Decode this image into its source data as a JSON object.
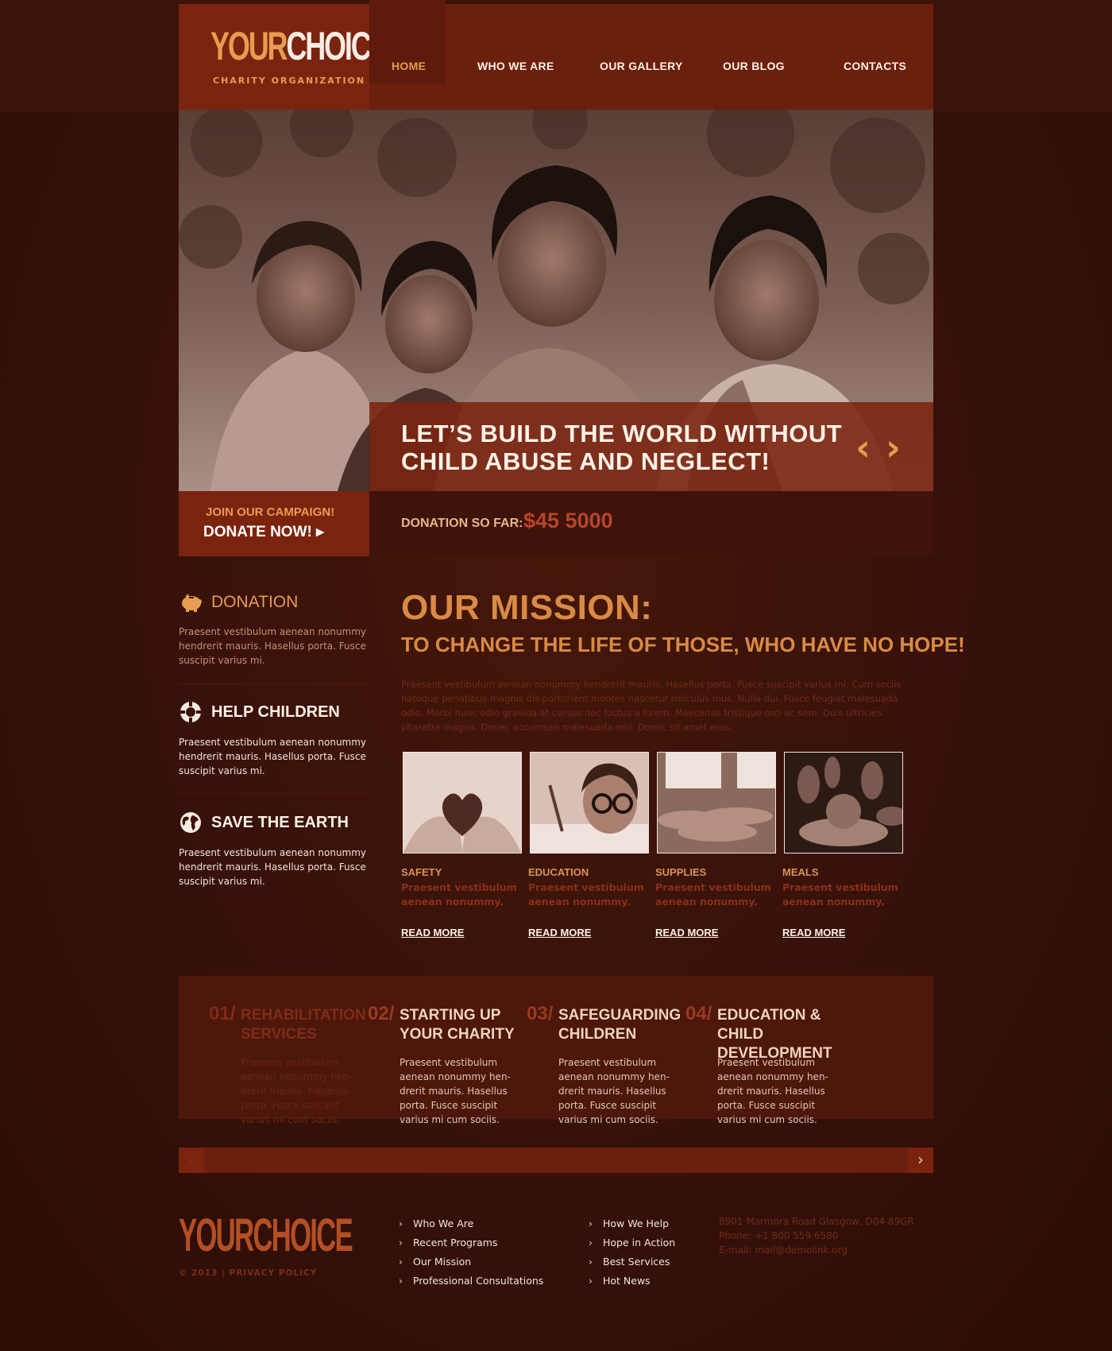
{
  "header": {
    "logo_your": "YOUR",
    "logo_choice": "CHOICE",
    "logo_sub": "CHARITY ORGANIZATION",
    "nav": [
      {
        "label": "HOME",
        "active": true
      },
      {
        "label": "WHO WE ARE"
      },
      {
        "label": "OUR GALLERY"
      },
      {
        "label": "OUR BLOG"
      },
      {
        "label": "CONTACTS"
      }
    ]
  },
  "hero": {
    "title": "LET’S BUILD THE WORLD WITHOUT CHILD ABUSE AND NEGLECT!",
    "prev_icon": "‹",
    "next_icon": "›"
  },
  "donate": {
    "join": "JOIN OUR CAMPAIGN!",
    "now": "DONATE NOW! ▸",
    "label": "DONATION SO FAR:",
    "amount": "$45 5000"
  },
  "side": [
    {
      "title": "DONATION",
      "icon": "piggy-bank-icon",
      "text": "Praesent vestibulum aenean nonummy hendrerit mauris. Hasellus porta. Fusce suscipit varius mi."
    },
    {
      "title": "HELP CHILDREN",
      "icon": "lifebuoy-icon",
      "text": "Praesent vestibulum aenean nonummy hendrerit mauris. Hasellus porta. Fusce suscipit varius mi."
    },
    {
      "title": "SAVE THE EARTH",
      "icon": "globe-icon",
      "text": "Praesent vestibulum aenean nonummy hendrerit mauris. Hasellus porta. Fusce suscipit varius mi."
    }
  ],
  "mission": {
    "title": "OUR MISSION:",
    "subtitle": "TO CHANGE THE LIFE OF THOSE, WHO HAVE NO HOPE!",
    "text": "Praesent vestibulum aenean nonummy hendrerit mauris. Hasellus porta. Fusce suscipit varius mi. Cum sociis natoque penatibus magnis dis parturient montes nascetur ridiculus mus. Nulla dui. Fusce feugiat malesuada odio. Morbi nunc odio gravida at cursus nec luctus a lorem. Maecenas tristique orci ac sem. Duis ultricies pharetra magna. Donec accumsan malesuada orci. Donec sit amet eros.",
    "cards": [
      {
        "title": "SAFETY",
        "text": "Praesent vestibulum aenean nonummy.",
        "link": "READ MORE"
      },
      {
        "title": "EDUCATION",
        "text": "Praesent vestibulum aenean nonummy.",
        "link": "READ MORE"
      },
      {
        "title": "SUPPLIES",
        "text": "Praesent vestibulum aenean nonummy.",
        "link": "READ MORE"
      },
      {
        "title": "MEALS",
        "text": "Praesent vestibulum aenean nonummy.",
        "link": "READ MORE"
      }
    ]
  },
  "programs": [
    {
      "num": "01/",
      "title": "REHABILITATION SERVICES",
      "text": "Praesent vestibulum aenean nonummy hen-drerit mauris. Hasellus porta. Fusce suscipit varius mi cum sociis."
    },
    {
      "num": "02/",
      "title": "STARTING UP YOUR CHARITY",
      "text": "Praesent vestibulum aenean nonummy hen-drerit mauris. Hasellus porta. Fusce suscipit varius mi cum sociis."
    },
    {
      "num": "03/",
      "title": "SAFEGUARDING CHILDREN",
      "text": "Praesent vestibulum aenean nonummy hen-drerit mauris. Hasellus porta. Fusce suscipit varius mi cum sociis."
    },
    {
      "num": "04/",
      "title": "EDUCATION & CHILD DEVELOPMENT",
      "text": "Praesent vestibulum aenean nonummy hen-drerit mauris. Hasellus porta. Fusce suscipit varius mi cum sociis."
    }
  ],
  "scroll": {
    "left": "‹",
    "right": "›"
  },
  "footer": {
    "logo": "YOURCHOICE",
    "copyright": "© 2013 | PRIVACY POLICY",
    "links_col1": [
      "Who We Are",
      "Recent Programs",
      "Our Mission",
      "Professional Consultations"
    ],
    "links_col2": [
      "How We Help",
      "Hope in Action",
      "Best Services",
      "Hot News"
    ],
    "address": "8901 Marmora Road Glasgow, D04 89GR",
    "phone": "Phone: +1 800 559 6580",
    "email": "E-mail: mail@demolink.org"
  },
  "colors": {
    "accent": "#e79c4f",
    "header_bg": "#6b1f0d",
    "page_bg": "#3a1208",
    "red_text": "#b8452a"
  }
}
